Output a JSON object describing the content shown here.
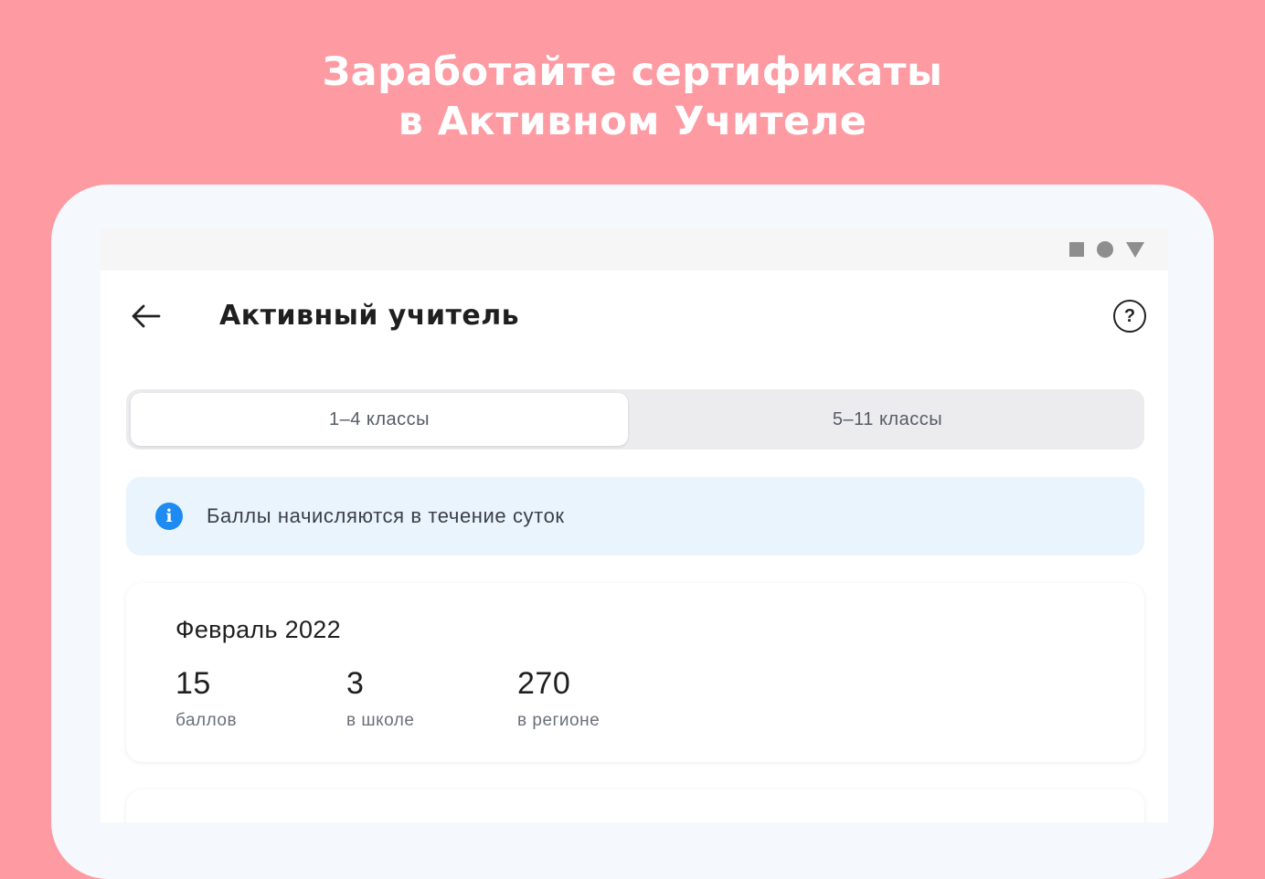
{
  "promo": {
    "line1": "Заработайте сертификаты",
    "line2": "в Активном Учителе"
  },
  "statusbar": {
    "icons": [
      "square-icon",
      "circle-icon",
      "triangle-down-icon"
    ]
  },
  "header": {
    "back_icon": "arrow-left-icon",
    "title": "Активный учитель",
    "help_icon": "help-circle-icon",
    "help_glyph": "?"
  },
  "tabs": [
    {
      "label": "1–4 классы",
      "active": true
    },
    {
      "label": "5–11 классы",
      "active": false
    }
  ],
  "info": {
    "icon": "info-icon",
    "icon_glyph": "i",
    "text": "Баллы начисляются в течение суток"
  },
  "stats_card": {
    "month": "Февраль 2022",
    "stats": [
      {
        "value": "15",
        "label": "баллов"
      },
      {
        "value": "3",
        "label": "в школе"
      },
      {
        "value": "270",
        "label": "в регионе"
      }
    ]
  },
  "colors": {
    "background": "#fd9aa2",
    "info_blue": "#1d8bf1",
    "info_bg": "#eaf4fd"
  }
}
